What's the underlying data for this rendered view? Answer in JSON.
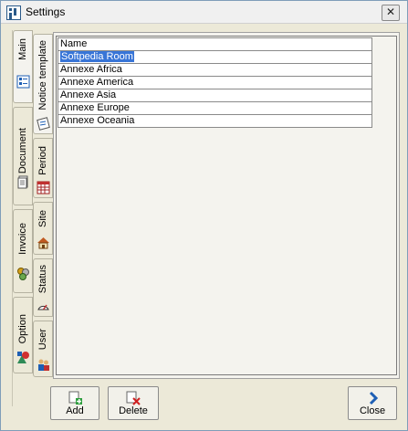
{
  "window": {
    "title": "Settings",
    "close_glyph": "✕"
  },
  "tabs_outer": [
    {
      "label": "Main",
      "icon": "main-list-icon"
    },
    {
      "label": "Document",
      "icon": "document-icon"
    },
    {
      "label": "Invoice",
      "icon": "invoice-coins-icon"
    },
    {
      "label": "Option",
      "icon": "option-shapes-icon"
    }
  ],
  "tabs_inner": [
    {
      "label": "Notice template",
      "icon": "notice-template-icon"
    },
    {
      "label": "Period",
      "icon": "calendar-icon"
    },
    {
      "label": "Site",
      "icon": "house-icon"
    },
    {
      "label": "Status",
      "icon": "gauge-icon"
    },
    {
      "label": "User",
      "icon": "users-icon"
    }
  ],
  "grid": {
    "header": "Name",
    "rows": [
      "Softpedia Room",
      "Annexe Africa",
      "Annexe America",
      "Annexe Asia",
      "Annexe Europe",
      "Annexe Oceania"
    ],
    "selected_index": 0
  },
  "buttons": {
    "add": "Add",
    "delete": "Delete",
    "close": "Close"
  },
  "colors": {
    "selection": "#3875d7",
    "accent_blue": "#1e5fb4"
  }
}
